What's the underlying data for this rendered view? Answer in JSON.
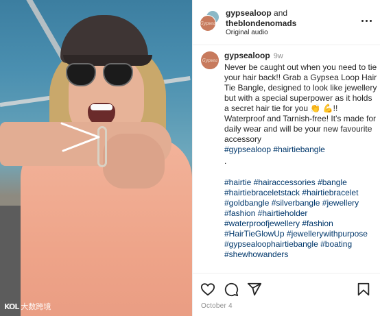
{
  "header": {
    "user1": "gypsealoop",
    "and": "and",
    "user2": "theblondenomads",
    "audio": "Original audio"
  },
  "caption": {
    "username": "gypsealoop",
    "time": "9w",
    "text": "Never be caught out when you need to tie your hair back!! Grab a Gypsea Loop Hair Tie Bangle, designed to look like jewellery but with a special superpower as it holds a secret hair tie for you 👏 💪!! Waterproof and Tarnish-free! It's made for daily wear and will be your new favourite accessory",
    "tags": "#gypsealoop #hairtiebangle",
    "separator": ".",
    "hashtags": "#hairtie #hairaccessories #bangle #hairtiebraceletstack #hairtiebracelet #goldbangle #silverbangle #jewellery #fashion #hairtieholder #waterproofjewellery #fashion #HairTieGlowUp #jewellerywithpurpose #gypsealoophairtiebangle #boating #shewhowanders"
  },
  "footer": {
    "date": "October 4"
  },
  "avatar_text": "Gypsea",
  "watermark": {
    "logo": "KOL",
    "text": "大数跨境"
  },
  "colors": {
    "link": "#00376b",
    "muted": "#8e8e8e",
    "avatar": "#c77a5d"
  },
  "icons": [
    "more-options-icon",
    "heart-icon",
    "comment-icon",
    "share-icon",
    "save-bookmark-icon"
  ]
}
